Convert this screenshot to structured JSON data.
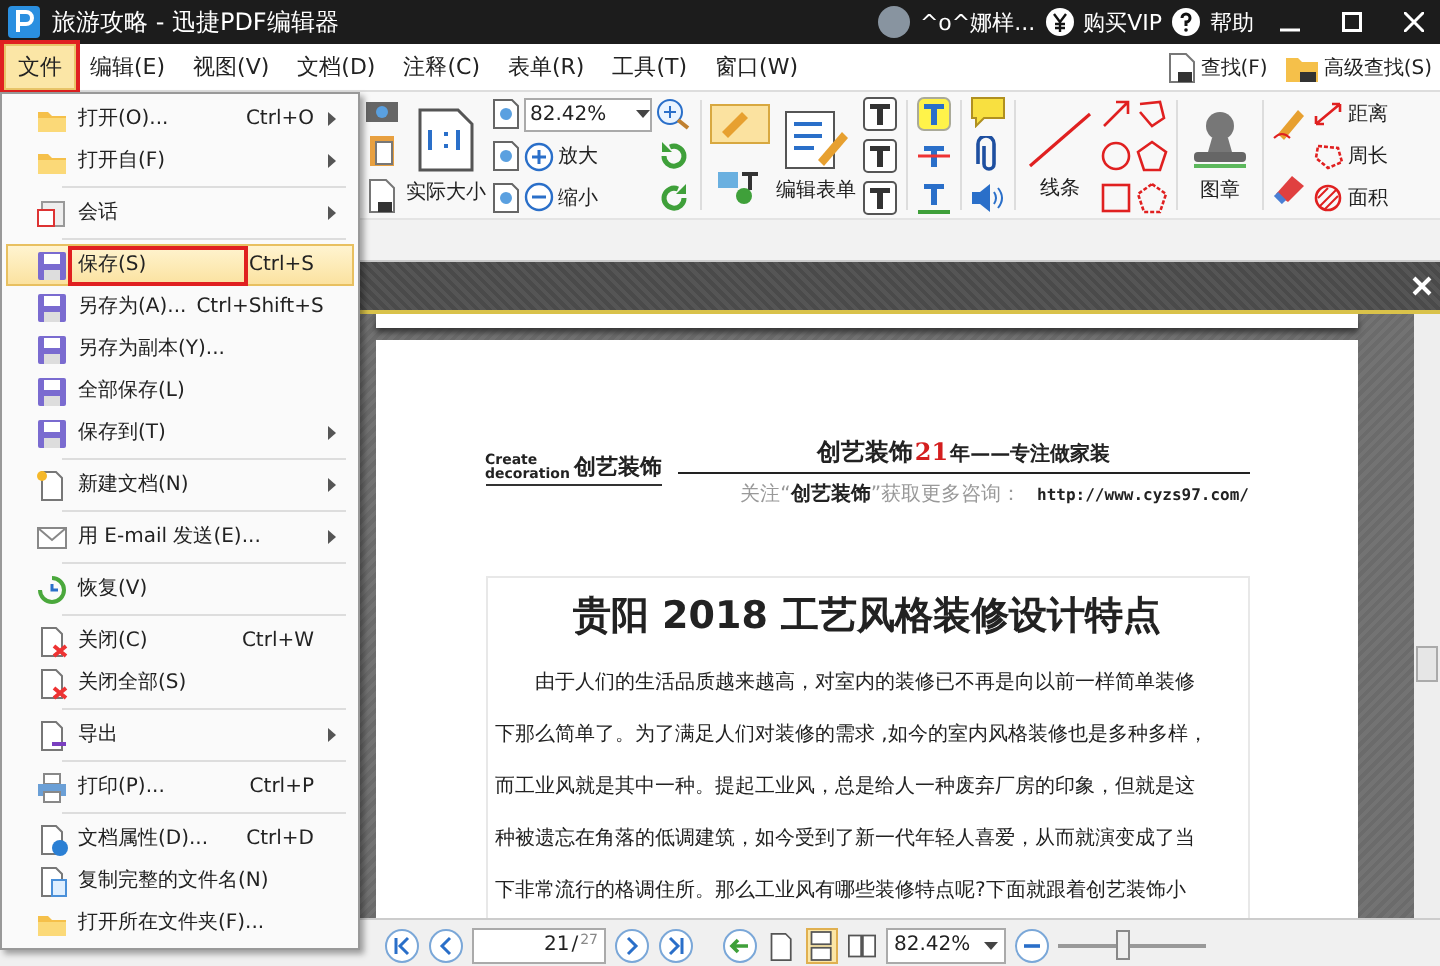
{
  "window": {
    "title": "旅游攻略 - 迅捷PDF编辑器",
    "user": "^o^娜样...",
    "buy_vip": "购买VIP",
    "help": "帮助"
  },
  "menu_bar": [
    {
      "label": "文件",
      "selected": true,
      "outlined": true
    },
    {
      "label": "编辑(E)",
      "selected": false,
      "outlined": false
    },
    {
      "label": "视图(V)",
      "selected": false,
      "outlined": false
    },
    {
      "label": "文档(D)",
      "selected": false,
      "outlined": false
    },
    {
      "label": "注释(C)",
      "selected": false,
      "outlined": false
    },
    {
      "label": "表单(R)",
      "selected": false,
      "outlined": false
    },
    {
      "label": "工具(T)",
      "selected": false,
      "outlined": false
    },
    {
      "label": "窗口(W)",
      "selected": false,
      "outlined": false
    }
  ],
  "find": "查找(F)",
  "advanced_find": "高级查找(S)",
  "ribbon": {
    "actual_size": "实际大小",
    "zoom": "82.42%",
    "zoom_in": "放大",
    "zoom_out": "缩小",
    "edit_form": "编辑表单",
    "line": "线条",
    "stamp": "图章",
    "distance": "距离",
    "perimeter": "周长",
    "area": "面积"
  },
  "file_menu": [
    {
      "kind": "item",
      "label": "打开(O)...",
      "shortcut": "Ctrl+O",
      "submenu": true,
      "selected": false,
      "outlined": false
    },
    {
      "kind": "item",
      "label": "打开自(F)",
      "submenu": true,
      "selected": false,
      "outlined": false
    },
    {
      "kind": "separator"
    },
    {
      "kind": "item",
      "label": "会话",
      "submenu": true,
      "selected": false,
      "outlined": false
    },
    {
      "kind": "separator"
    },
    {
      "kind": "item",
      "label": "保存(S)",
      "shortcut": "Ctrl+S",
      "submenu": false,
      "selected": true,
      "outlined": true
    },
    {
      "kind": "item",
      "label": "另存为(A)...",
      "shortcut": "Ctrl+Shift+S",
      "submenu": false,
      "selected": false,
      "outlined": false
    },
    {
      "kind": "item",
      "label": "另存为副本(Y)...",
      "submenu": false,
      "selected": false,
      "outlined": false
    },
    {
      "kind": "item",
      "label": "全部保存(L)",
      "submenu": false,
      "selected": false,
      "outlined": false
    },
    {
      "kind": "item",
      "label": "保存到(T)",
      "submenu": true,
      "selected": false,
      "outlined": false
    },
    {
      "kind": "separator"
    },
    {
      "kind": "item",
      "label": "新建文档(N)",
      "submenu": true,
      "selected": false,
      "outlined": false
    },
    {
      "kind": "separator"
    },
    {
      "kind": "item",
      "label": "用 E-mail 发送(E)...",
      "submenu": true,
      "selected": false,
      "outlined": false
    },
    {
      "kind": "separator"
    },
    {
      "kind": "item",
      "label": "恢复(V)",
      "submenu": false,
      "selected": false,
      "outlined": false
    },
    {
      "kind": "separator"
    },
    {
      "kind": "item",
      "label": "关闭(C)",
      "shortcut": "Ctrl+W",
      "submenu": false,
      "selected": false,
      "outlined": false
    },
    {
      "kind": "item",
      "label": "关闭全部(S)",
      "submenu": false,
      "selected": false,
      "outlined": false
    },
    {
      "kind": "separator"
    },
    {
      "kind": "item",
      "label": "导出",
      "submenu": true,
      "selected": false,
      "outlined": false
    },
    {
      "kind": "separator"
    },
    {
      "kind": "item",
      "label": "打印(P)...",
      "shortcut": "Ctrl+P",
      "submenu": false,
      "selected": false,
      "outlined": false
    },
    {
      "kind": "separator"
    },
    {
      "kind": "item",
      "label": "文档属性(D)...",
      "shortcut": "Ctrl+D",
      "submenu": false,
      "selected": false,
      "outlined": false
    },
    {
      "kind": "item",
      "label": "复制完整的文件名(N)",
      "submenu": false,
      "selected": false,
      "outlined": false
    },
    {
      "kind": "item",
      "label": "打开所在文件夹(F)...",
      "submenu": false,
      "selected": false,
      "outlined": false
    }
  ],
  "document": {
    "logo": {
      "word_1": "Create",
      "word_2": "decoration",
      "brand": "创艺装饰"
    },
    "header": {
      "brand": "创艺装饰",
      "years": "21",
      "slogan": "年——专注做家装",
      "follow": "关注“**创艺装饰**”获取更多咨询：",
      "url": "http://www.cyzs97.com/"
    },
    "title": "贵阳 2018 工艺风格装修设计特点",
    "lines": [
      "由于人们的生活品质越来越高，对室内的装修已不再是向以前一样简单装修",
      "下那么简单了。为了满足人们对装修的需求 ,如今的室内风格装修也是多种多样，",
      "而工业风就是其中一种。提起工业风，总是给人一种废弃厂房的印象，但就是这",
      "种被遗忘在角落的低调建筑，如今受到了新一代年轻人喜爱，从而就演变成了当",
      "下非常流行的格调住所。那么工业风有哪些装修特点呢?下面就跟着创艺装饰小"
    ]
  },
  "status_bar": {
    "page": "21",
    "page_separator": "/",
    "page_count": "27",
    "zoom": "82.42%",
    "level": 0.43,
    "page_modes": [
      {
        "kind": "single",
        "selected": false
      },
      {
        "kind": "continuous",
        "selected": true
      },
      {
        "kind": "facing",
        "selected": false
      }
    ]
  }
}
